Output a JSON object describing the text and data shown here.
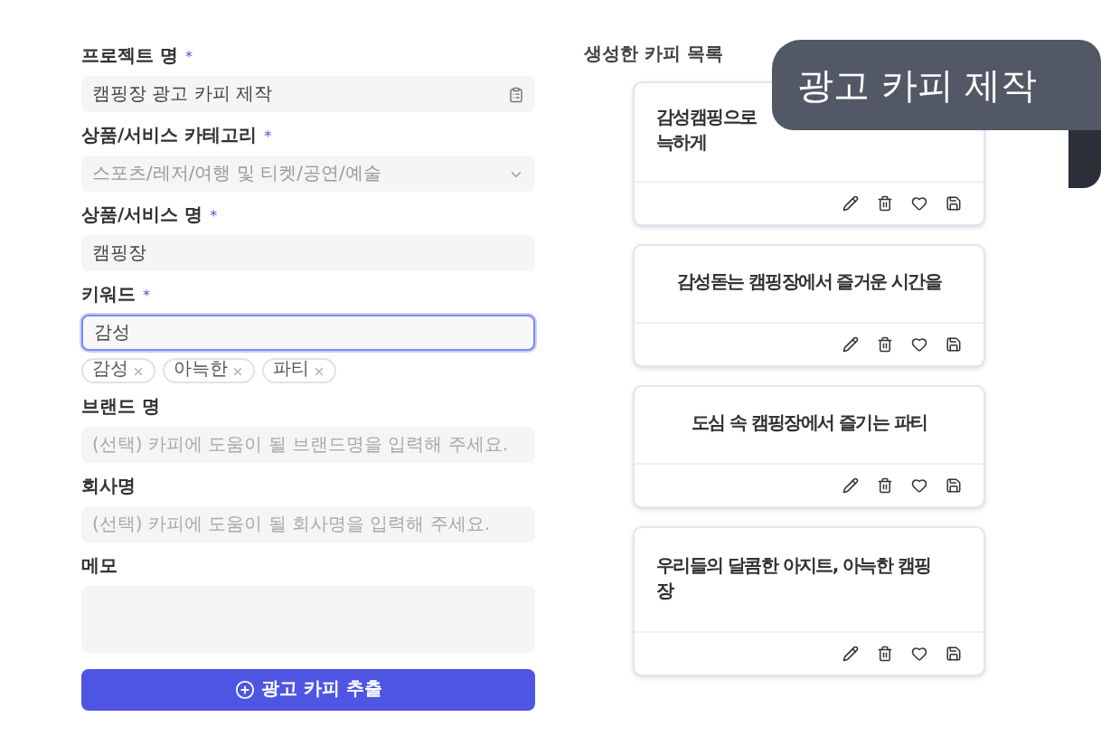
{
  "form": {
    "fields": [
      {
        "kind": "clipboard-input",
        "label": "프로젝트 명",
        "required_mark": "*",
        "value": "캠핑장 광고 카피 제작",
        "focused": false
      },
      {
        "kind": "select",
        "label": "상품/서비스 카테고리",
        "required_mark": "*",
        "value": "스포츠/레저/여행 및 티켓/공연/예술",
        "focused": false
      },
      {
        "kind": "input",
        "label": "상품/서비스 명",
        "required_mark": "*",
        "value": "캠핑장",
        "focused": false
      },
      {
        "kind": "input",
        "label": "키워드",
        "required_mark": "*",
        "value": "감성",
        "focused": true,
        "tags": [
          "감성",
          "아늑한",
          "파티"
        ]
      },
      {
        "kind": "input",
        "label": "브랜드 명",
        "placeholder": "(선택) 카피에 도움이 될 브랜드명을 입력해 주세요.",
        "focused": false
      },
      {
        "kind": "input",
        "label": "회사명",
        "placeholder": "(선택) 카피에 도움이 될 회사명을 입력해 주세요.",
        "focused": false
      },
      {
        "kind": "textarea",
        "label": "메모",
        "focused": false
      }
    ],
    "submit": "광고 카피 추출"
  },
  "copies": {
    "title": "생성한 카피 목록",
    "cards": [
      {
        "kind": "left",
        "lines": [
          "감성캠핑으로",
          "늑하게"
        ]
      },
      {
        "kind": "centered",
        "lines": [
          "감성돋는 캠핑장에서 즐거운 시간을"
        ]
      },
      {
        "kind": "centered",
        "lines": [
          "도심 속 캠핑장에서 즐기는 파티"
        ]
      },
      {
        "kind": "left",
        "lines": [
          "우리들의 달콤한 아지트, 아늑한 캠핑",
          "장"
        ]
      }
    ]
  },
  "banner": {
    "title": "광고 카피 제작"
  }
}
